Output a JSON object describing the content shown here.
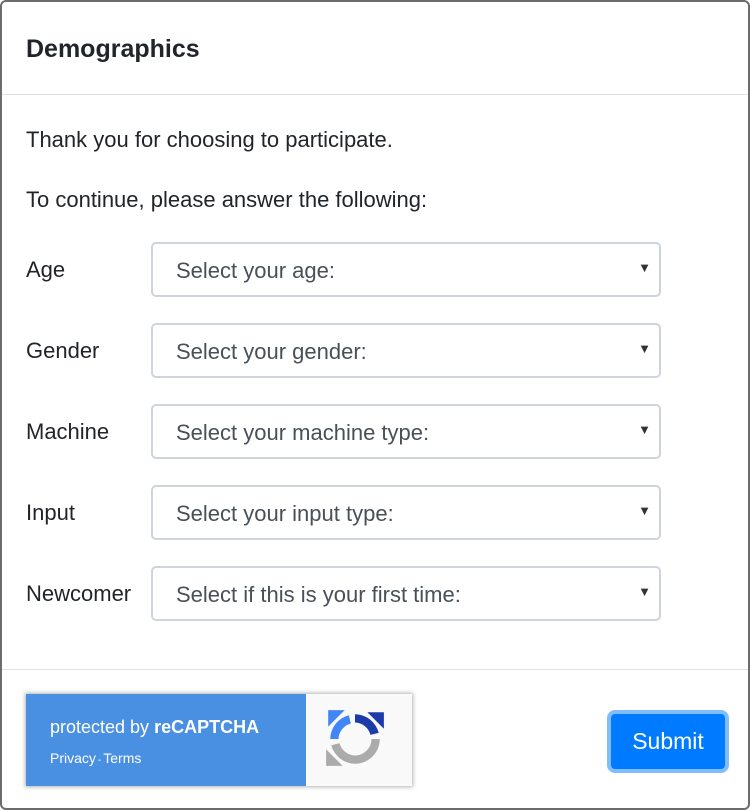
{
  "dialog": {
    "title": "Demographics",
    "intro": "Thank you for choosing to participate.",
    "instruction": "To continue, please answer the following:"
  },
  "fields": [
    {
      "label": "Age",
      "placeholder": "Select your age:"
    },
    {
      "label": "Gender",
      "placeholder": "Select your gender:"
    },
    {
      "label": "Machine",
      "placeholder": "Select your machine type:"
    },
    {
      "label": "Input",
      "placeholder": "Select your input type:"
    },
    {
      "label": "Newcomer",
      "placeholder": "Select if this is your first time:"
    }
  ],
  "recaptcha": {
    "protected_prefix": "protected by ",
    "brand": "reCAPTCHA",
    "privacy": "Privacy",
    "separator": "-",
    "terms": "Terms",
    "icon": "recaptcha-logo"
  },
  "footer": {
    "submit_label": "Submit"
  },
  "icons": {
    "dropdown": "caret-down-icon"
  },
  "colors": {
    "primary": "#007bff",
    "recaptcha_blue": "#4a90e2"
  }
}
